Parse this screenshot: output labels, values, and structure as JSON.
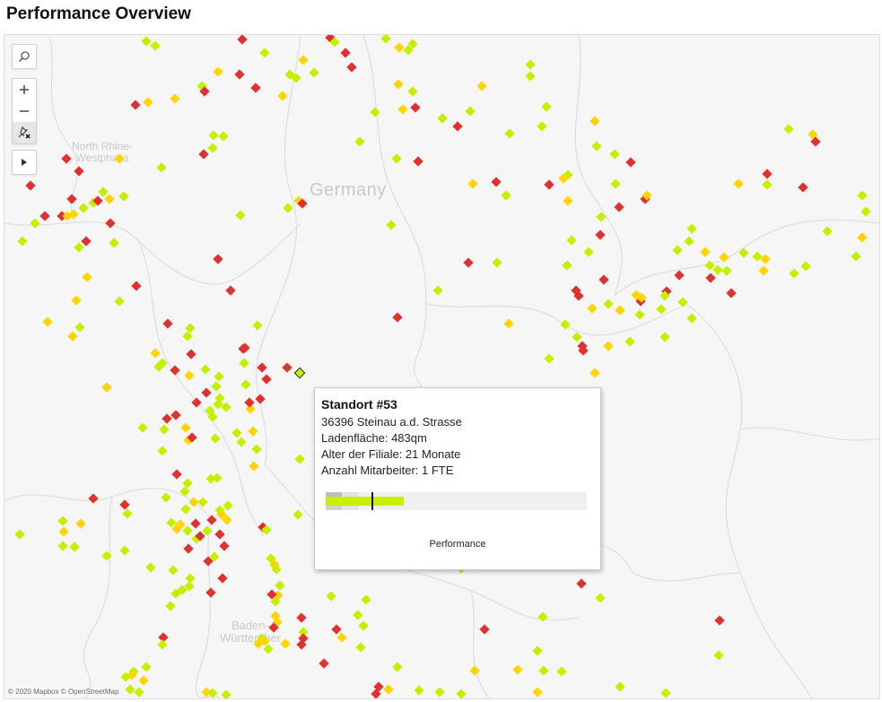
{
  "page": {
    "title": "Performance Overview"
  },
  "map": {
    "labels": {
      "north_rhine": "North Rhine-\nWestphalia",
      "germany": "Germany",
      "baden": "Baden-\nWürttember"
    },
    "attribution": "© 2020 Mapbox © OpenStreetMap",
    "controls": {
      "search_icon": "search-icon",
      "zoom_in_icon": "plus-icon",
      "zoom_out_icon": "minus-icon",
      "reset_icon": "pin-reset-icon",
      "play_icon": "play-icon"
    },
    "colors": {
      "red": "#e03131",
      "yellow": "#ffd400",
      "green": "#c4f000",
      "highlight_border": "#2a2a2a"
    }
  },
  "tooltip": {
    "title": "Standort #53",
    "address": "36396 Steinau a.d. Strasse",
    "ladenflaeche": "Ladenfläche: 483qm",
    "alter": "Alter der Filiale: 21 Monate",
    "mitarbeiter": "Anzahl Mitarbeiter: 1 FTE",
    "bar_caption": "Performance",
    "performance_fill": 0.3,
    "marker_position": 0.175
  }
}
